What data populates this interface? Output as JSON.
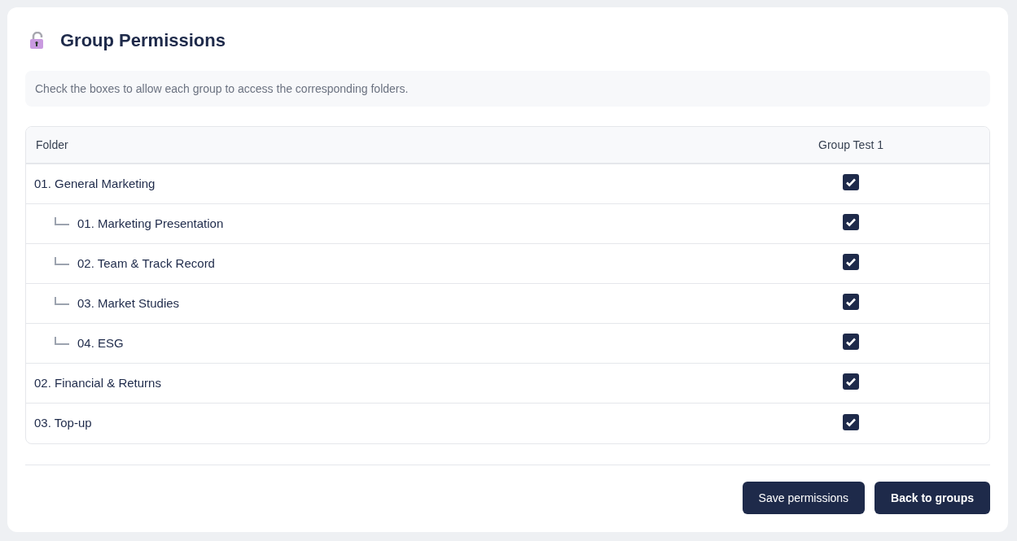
{
  "title": "Group Permissions",
  "info": "Check the boxes to allow each group to access the corresponding folders.",
  "table": {
    "columns": [
      "Folder",
      "Group Test 1"
    ],
    "rows": [
      {
        "folder": "01. General Marketing",
        "checked": true,
        "children": [
          {
            "folder": "01. Marketing Presentation",
            "checked": true
          },
          {
            "folder": "02. Team & Track Record",
            "checked": true
          },
          {
            "folder": "03. Market Studies",
            "checked": true
          },
          {
            "folder": "04. ESG",
            "checked": true
          }
        ]
      },
      {
        "folder": "02. Financial & Returns",
        "checked": true
      },
      {
        "folder": "03. Top-up",
        "checked": true
      }
    ]
  },
  "buttons": [
    "Save permissions",
    "Back to groups"
  ]
}
